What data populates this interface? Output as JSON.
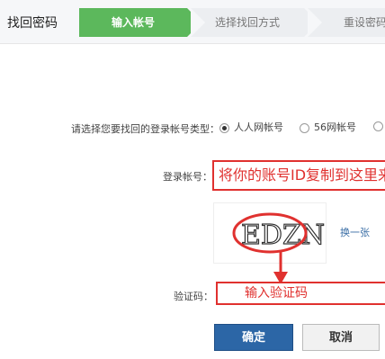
{
  "header": {
    "title": "找回密码",
    "steps": [
      "输入帐号",
      "选择找回方式",
      "重设密码"
    ]
  },
  "form": {
    "account_type_label": "请选择您要找回的登录帐号类型：",
    "account_types": [
      {
        "label": "人人网帐号",
        "selected": true
      },
      {
        "label": "56网帐号",
        "selected": false
      },
      {
        "label": "",
        "selected": false
      }
    ],
    "account_label": "登录帐号：",
    "account_value": "将你的账号ID复制到这里来",
    "captcha_text": "EDZN",
    "change_captcha": "换一张",
    "code_label": "验证码：",
    "code_value": "输入验证码",
    "confirm": "确定",
    "cancel": "取消"
  },
  "colors": {
    "accent_green": "#5cb85c",
    "annotation_red": "#e0312f",
    "button_blue": "#2c66a6"
  }
}
